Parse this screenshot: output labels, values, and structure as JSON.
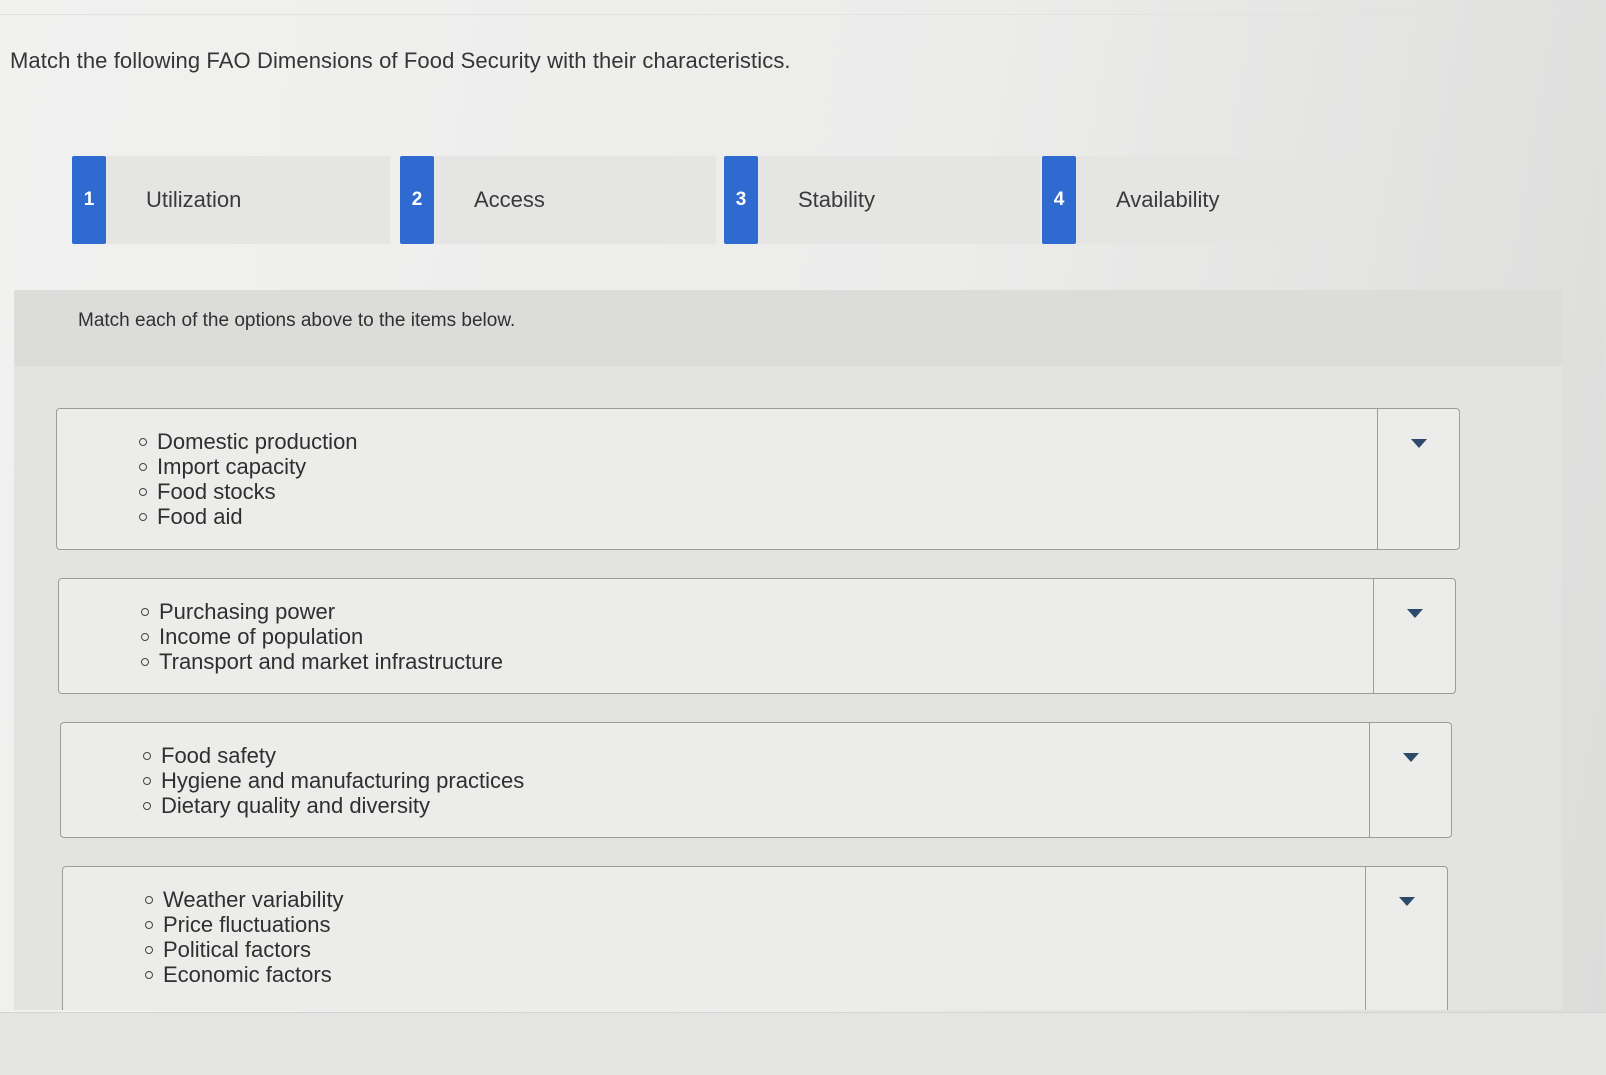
{
  "question": "Match the following FAO Dimensions of Food Security with their characteristics.",
  "options": [
    {
      "number": "1",
      "label": "Utilization"
    },
    {
      "number": "2",
      "label": "Access"
    },
    {
      "number": "3",
      "label": "Stability"
    },
    {
      "number": "4",
      "label": "Availability"
    }
  ],
  "instruction": "Match each of the options above to the items below.",
  "items": [
    {
      "lines": [
        "Domestic production",
        "Import capacity",
        "Food stocks",
        "Food aid"
      ]
    },
    {
      "lines": [
        "Purchasing power",
        "Income of population",
        "Transport and market infrastructure"
      ]
    },
    {
      "lines": [
        "Food safety",
        "Hygiene and manufacturing practices",
        "Dietary quality and diversity"
      ]
    },
    {
      "lines": [
        "Weather variability",
        "Price fluctuations",
        "Political factors",
        "Economic factors"
      ]
    }
  ],
  "icons": {
    "dropdown": "chevron-down-icon",
    "bullet": "hollow-circle-bullet"
  },
  "colors": {
    "option_number_bg": "#2f6ad1",
    "caret": "#2d4a6b"
  }
}
